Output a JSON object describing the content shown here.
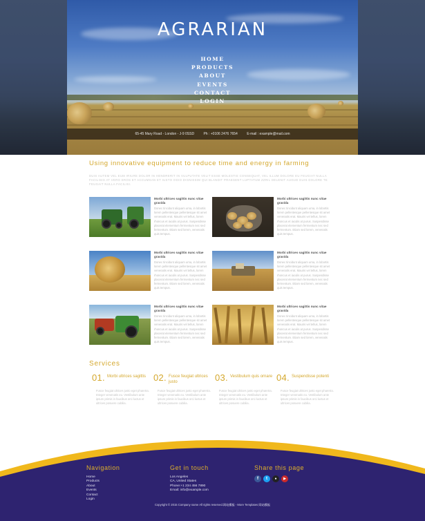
{
  "hero": {
    "title": "AGRARIAN",
    "nav": [
      "HOME",
      "PRODUCTS",
      "ABOUT",
      "EVENTS",
      "CONTACT",
      "LOGIN"
    ],
    "address": "65-45 Mary Road - London - J-9 0SSD",
    "phone": "Ph : +0106 2476 7654",
    "email": "E-mail : example@mail.com"
  },
  "intro": {
    "heading": "Using innovative equipment to reduce time and energy in farming",
    "text": "DUIS AUTEM VEL EUM IRIURE DOLOR IN HENDRERIT IN VULPUTATE VELIT ESSE MOLESTIE CONSEQUAT, VEL ILLUM DOLORE EU FEUGIAT NULLA FACILISIS AT VERO EROS ET ACCUMSAN ET IUSTO ODIO DIGNISSIM QUI BLANDIT PRAESENT LUPTATUM ZZRIL DELENIT AUGUE DUIS DOLORE TE FEUGAIT NULLA FACILISI."
  },
  "cards": [
    {
      "title": "Morbi ultrices sagittis nunc vitae gravida",
      "text": "Donec tincidunt aliquam urna, in lobortis lorem pellentesque pellentesque sit amet venenatis erat. Mauris vel tellus, lorem rhoncus et iaculis at purus. Suspendisse placerat elementum fermentum nec sed fermentum. Etiam sed lorem, venenatis quis tempus."
    },
    {
      "title": "Morbi ultrices sagittis nunc vitae gravida",
      "text": "Donec tincidunt aliquam urna, in lobortis lorem pellentesque pellentesque sit amet venenatis erat. Mauris vel tellus, lorem rhoncus et iaculis at purus. Suspendisse placerat elementum fermentum nec sed fermentum. Etiam sed lorem, venenatis quis tempus."
    },
    {
      "title": "Morbi ultrices sagittis nunc vitae gravida",
      "text": "Donec tincidunt aliquam urna, in lobortis lorem pellentesque pellentesque sit amet venenatis erat. Mauris vel tellus, lorem rhoncus et iaculis at purus. Suspendisse placerat elementum fermentum nec sed fermentum. Etiam sed lorem, venenatis quis tempus."
    },
    {
      "title": "Morbi ultrices sagittis nunc vitae gravida",
      "text": "Donec tincidunt aliquam urna, in lobortis lorem pellentesque pellentesque sit amet venenatis erat. Mauris vel tellus, lorem rhoncus et iaculis at purus. Suspendisse placerat elementum fermentum nec sed fermentum. Etiam sed lorem, venenatis quis tempus."
    },
    {
      "title": "Morbi ultrices sagittis nunc vitae gravida",
      "text": "Donec tincidunt aliquam urna, in lobortis lorem pellentesque pellentesque sit amet venenatis erat. Mauris vel tellus, lorem rhoncus et iaculis at purus. Suspendisse placerat elementum fermentum nec sed fermentum. Etiam sed lorem, venenatis quis tempus."
    },
    {
      "title": "Morbi ultrices sagittis nunc vitae gravida",
      "text": "Donec tincidunt aliquam urna, in lobortis lorem pellentesque pellentesque sit amet venenatis erat. Mauris vel tellus, lorem rhoncus et iaculis at purus. Suspendisse placerat elementum fermentum nec sed fermentum. Etiam sed lorem, venenatis quis tempus."
    }
  ],
  "services": {
    "heading": "Services",
    "items": [
      {
        "num": "01.",
        "title": "Morbi ultrices sagittis",
        "text": "Fusce feugiat ultrices justo eget pharetra. Integer venenatis eu. Vestibulum ante ipsum primis in faucibus orci luctus et ultrices posuere cubilia."
      },
      {
        "num": "02.",
        "title": "Fusce feugiat ultrices justo",
        "text": "Fusce feugiat ultrices justo eget pharetra. Integer venenatis eu. Vestibulum ante ipsum primis in faucibus orci luctus et ultrices posuere cubilia."
      },
      {
        "num": "03.",
        "title": "Vestibulum quis ornare",
        "text": "Fusce feugiat ultrices justo eget pharetra. Integer venenatis eu. Vestibulum ante ipsum primis in faucibus orci luctus et ultrices posuere cubilia."
      },
      {
        "num": "04.",
        "title": "Suspendisse potenti",
        "text": "Fusce feugiat ultrices justo eget pharetra. Integer venenatis eu. Vestibulum ante ipsum primis in faucibus orci luctus et ultrices posuere cubilia."
      }
    ]
  },
  "footer": {
    "nav_heading": "Navigation",
    "nav_links": [
      "Home",
      "Products",
      "About",
      "Events",
      "Contact",
      "Login"
    ],
    "contact_heading": "Get in touch",
    "contact_lines": [
      "Los Angeles",
      "CA, United States",
      "Phone:+1 234 456 7890",
      "Email: info@example.com"
    ],
    "share_heading": "Share this page",
    "social": [
      {
        "icon": "facebook-icon",
        "glyph": "f",
        "color": "#3b5998"
      },
      {
        "icon": "twitter-icon",
        "glyph": "t",
        "color": "#1da1f2"
      },
      {
        "icon": "flickr-icon",
        "glyph": "●",
        "color": "#222222"
      },
      {
        "icon": "youtube-icon",
        "glyph": "▶",
        "color": "#cc2a2a"
      }
    ],
    "copyright": "Copyright © 2015 Company name All rights reserved.网站模板 - More Templates 网站模板"
  },
  "colors": {
    "accent": "#d4a72c",
    "footer_bg": "#2e2370",
    "footer_curve": "#f0b81c"
  }
}
